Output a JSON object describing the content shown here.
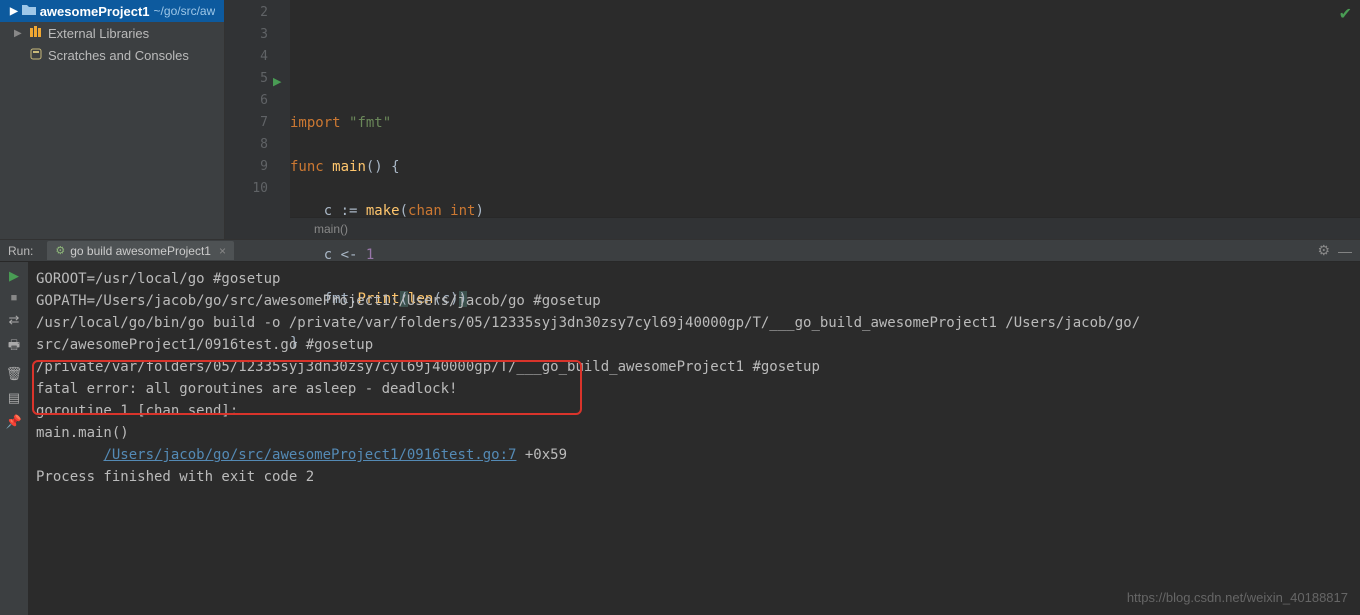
{
  "project": {
    "name": "awesomeProject1",
    "path": "~/go/src/aw"
  },
  "tree": {
    "external_libs": "External Libraries",
    "scratches": "Scratches and Consoles"
  },
  "editor": {
    "line_numbers": [
      "2",
      "3",
      "4",
      "5",
      "6",
      "7",
      "8",
      "9",
      "10"
    ],
    "breadcrumb": "main()",
    "lines": {
      "import_kw": "import",
      "import_str": "\"fmt\"",
      "func_kw": "func",
      "main_id": "main",
      "main_parens": "() {",
      "c_assign": "c := ",
      "make_fn": "make",
      "make_inner_pre": "(",
      "chan_kw": "chan",
      "int_kw": " int",
      "make_inner_post": ")",
      "send": "c <- ",
      "send_val": "1",
      "fmt_print": "fmt.",
      "print_fn": "Print",
      "len_fn": "len",
      "len_arg": "(c)",
      "close_brace": "}"
    }
  },
  "run": {
    "panel_label": "Run:",
    "tab_label": "go build awesomeProject1",
    "output": {
      "l1": "GOROOT=/usr/local/go #gosetup",
      "l2": "GOPATH=/Users/jacob/go/src/awesomeProject1:/Users/jacob/go #gosetup",
      "l3": "/usr/local/go/bin/go build -o /private/var/folders/05/12335syj3dn30zsy7cyl69j40000gp/T/___go_build_awesomeProject1 /Users/jacob/go/",
      "l4": "src/awesomeProject1/0916test.go #gosetup",
      "l5": "/private/var/folders/05/12335syj3dn30zsy7cyl69j40000gp/T/___go_build_awesomeProject1 #gosetup",
      "l6": "fatal error: all goroutines are asleep - deadlock!",
      "l_blank": "",
      "l7": "goroutine 1 [chan send]:",
      "l8": "main.main()",
      "l9_indent": "        ",
      "l9_link": "/Users/jacob/go/src/awesomeProject1/0916test.go:7",
      "l9_tail": " +0x59",
      "l10": "",
      "l11": "Process finished with exit code 2"
    }
  },
  "watermark": "https://blog.csdn.net/weixin_40188817"
}
